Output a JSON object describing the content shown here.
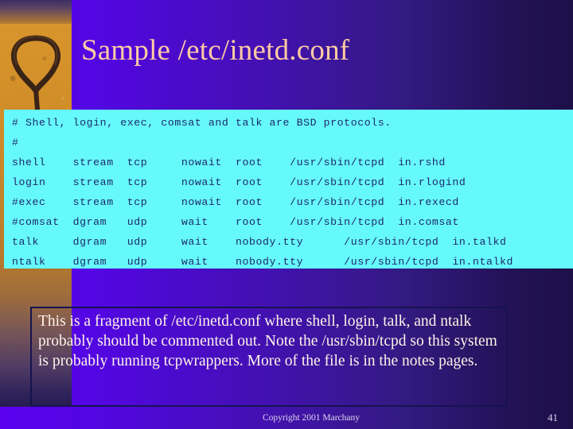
{
  "slide": {
    "title": "Sample /etc/inetd.conf",
    "decorative_image_name": "branding-iron-on-sand-photo",
    "colors": {
      "background_left": "#5a00f0",
      "background_right": "#1d1048",
      "title_text": "#ffcba4",
      "code_background": "#66f9fb",
      "code_text": "#1c2a6b",
      "body_text": "#fdf3e8",
      "body_box_border": "#16134f",
      "sand": "#d08c27"
    }
  },
  "code": {
    "lines": [
      "# Shell, login, exec, comsat and talk are BSD protocols.",
      "#",
      "shell    stream  tcp     nowait  root    /usr/sbin/tcpd  in.rshd",
      "login    stream  tcp     nowait  root    /usr/sbin/tcpd  in.rlogind",
      "#exec    stream  tcp     nowait  root    /usr/sbin/tcpd  in.rexecd",
      "#comsat  dgram   udp     wait    root    /usr/sbin/tcpd  in.comsat",
      "talk     dgram   udp     wait    nobody.tty      /usr/sbin/tcpd  in.talkd",
      "ntalk    dgram   udp     wait    nobody.tty      /usr/sbin/tcpd  in.ntalkd"
    ]
  },
  "body": {
    "text": "This is a fragment of /etc/inetd.conf where shell, login, talk, and ntalk probably should be commented out.  Note the /usr/sbin/tcpd so this system is probably running tcpwrappers.  More of the file is in the notes pages."
  },
  "footer": {
    "copyright": "Copyright 2001 Marchany",
    "page_number": "41"
  }
}
